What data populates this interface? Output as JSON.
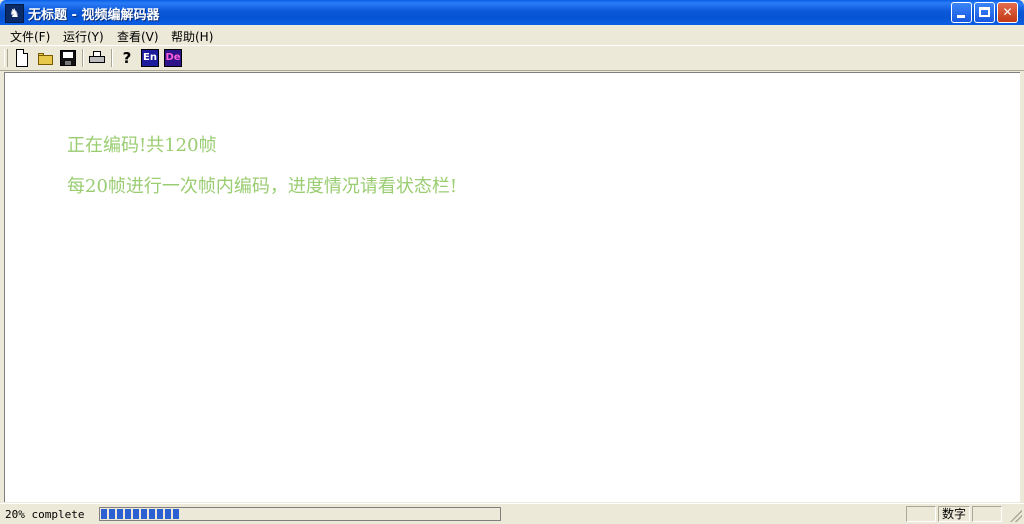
{
  "window": {
    "title": "无标题 - 视频编解码器",
    "app_icon": "film-icon"
  },
  "menubar": {
    "items": [
      {
        "label": "文件(F)"
      },
      {
        "label": "运行(Y)"
      },
      {
        "label": "查看(V)"
      },
      {
        "label": "帮助(H)"
      }
    ]
  },
  "toolbar": {
    "help_glyph": "?",
    "encode_label": "En",
    "decode_label": "De"
  },
  "content": {
    "line1": "正在编码!共120帧",
    "line2": "每20帧进行一次帧内编码，进度情况请看状态栏!",
    "text_color": "#9acd72"
  },
  "statusbar": {
    "text": "20% complete",
    "progress": 0.2,
    "indicator": "数字"
  }
}
